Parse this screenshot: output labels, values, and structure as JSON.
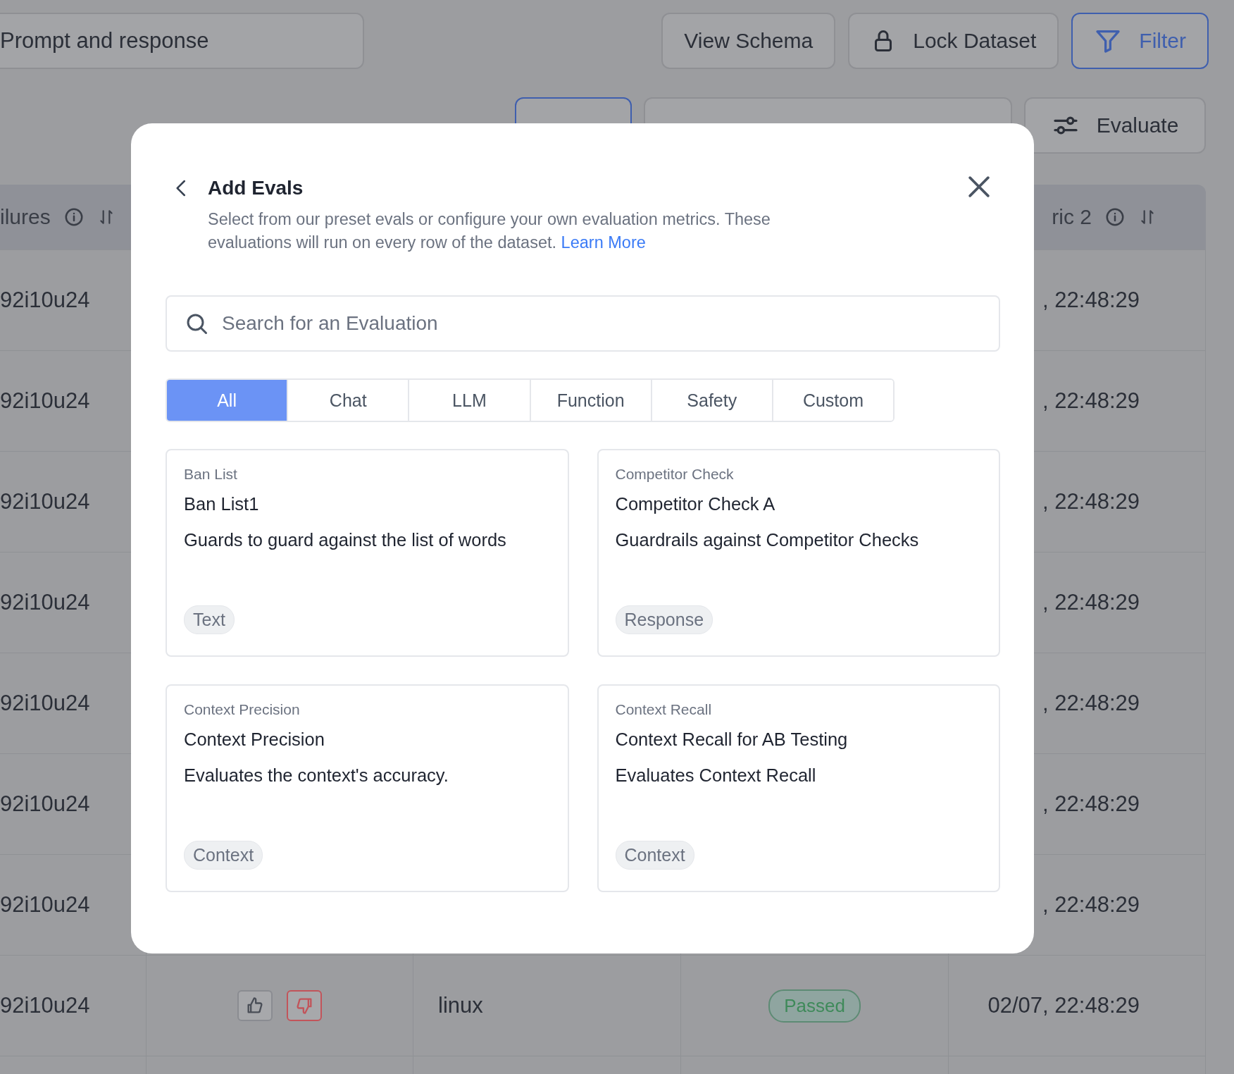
{
  "toolbar": {
    "dataset_name": "Prompt and response",
    "buttons": [
      {
        "label": "View Schema",
        "kind": "plain"
      },
      {
        "label": "Lock Dataset",
        "kind": "lock"
      },
      {
        "label": "Filter",
        "kind": "filter"
      }
    ],
    "evaluate_label": "Evaluate"
  },
  "table": {
    "header_left": "ilures",
    "header_right": "ric 2",
    "rows": [
      {
        "id": "92i10u24",
        "time": ", 22:48:29"
      },
      {
        "id": "92i10u24",
        "time": ", 22:48:29"
      },
      {
        "id": "92i10u24",
        "time": ", 22:48:29"
      },
      {
        "id": "92i10u24",
        "time": ", 22:48:29"
      },
      {
        "id": "92i10u24",
        "time": ", 22:48:29"
      },
      {
        "id": "92i10u24",
        "time": ", 22:48:29"
      },
      {
        "id": "92i10u24",
        "time": ", 22:48:29"
      },
      {
        "id": "92i10u24",
        "os": "linux",
        "status": "Passed",
        "time": "02/07, 22:48:29"
      }
    ]
  },
  "modal": {
    "title": "Add Evals",
    "description": "Select from our preset evals or configure your own evaluation metrics. These evaluations will run on every row of the dataset.",
    "link": "Learn More",
    "search_placeholder": "Search for an Evaluation",
    "tabs": [
      {
        "label": "All",
        "selected": true
      },
      {
        "label": "Chat",
        "selected": false
      },
      {
        "label": "LLM",
        "selected": false
      },
      {
        "label": "Function",
        "selected": false
      },
      {
        "label": "Safety",
        "selected": false
      },
      {
        "label": "Custom",
        "selected": false
      }
    ],
    "cards": [
      {
        "category": "Ban List",
        "title": "Ban List1",
        "description": "Guards to guard against the list of words",
        "tag": "Text"
      },
      {
        "category": "Competitor Check",
        "title": "Competitor Check A",
        "description": "Guardrails against Competitor Checks",
        "tag": "Response"
      },
      {
        "category": "Context Precision",
        "title": "Context Precision",
        "description": "Evaluates the context's accuracy.",
        "tag": "Context"
      },
      {
        "category": "Context Recall",
        "title": "Context Recall for AB Testing",
        "description": "Evaluates Context Recall",
        "tag": "Context"
      }
    ]
  }
}
